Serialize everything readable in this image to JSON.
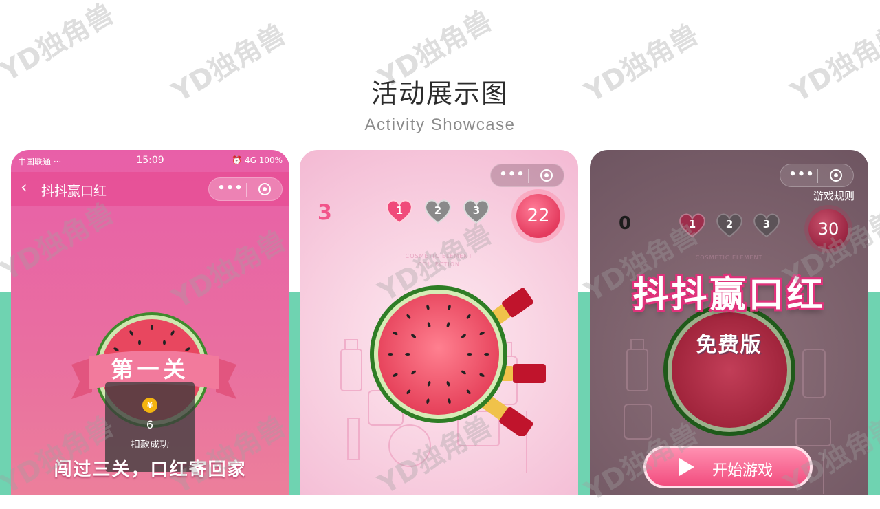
{
  "header": {
    "title": "活动展示图",
    "subtitle": "Activity Showcase"
  },
  "watermark": "YD独角兽",
  "phone1": {
    "status": {
      "carrier": "中国联通 ···",
      "time": "15:09",
      "right": "⏰ 4G 100%"
    },
    "nav_title": "抖抖赢口红",
    "capsule_dots": "•••",
    "ribbon": "第一关",
    "toast": {
      "coin": "¥",
      "amount": "6",
      "message": "扣款成功"
    },
    "slogan": "闯过三关，口红寄回家"
  },
  "phone2": {
    "capsule_dots": "•••",
    "level": "3",
    "hearts": [
      "1",
      "2",
      "3"
    ],
    "score": "22",
    "deco_line1": "COSMETIC ELEMENT",
    "deco_line2": "COLLECTION"
  },
  "phone3": {
    "capsule_dots": "•••",
    "rules": "游戏规则",
    "level": "0",
    "hearts": [
      "1",
      "2",
      "3"
    ],
    "score": "30",
    "deco_line1": "COSMETIC ELEMENT",
    "title": "抖抖赢口红",
    "subtitle": "免费版",
    "start_label": "开始游戏"
  },
  "colors": {
    "accent_green": "#6fd3b1",
    "pink": "#e85fa8",
    "watermelon": "#e8475f"
  }
}
